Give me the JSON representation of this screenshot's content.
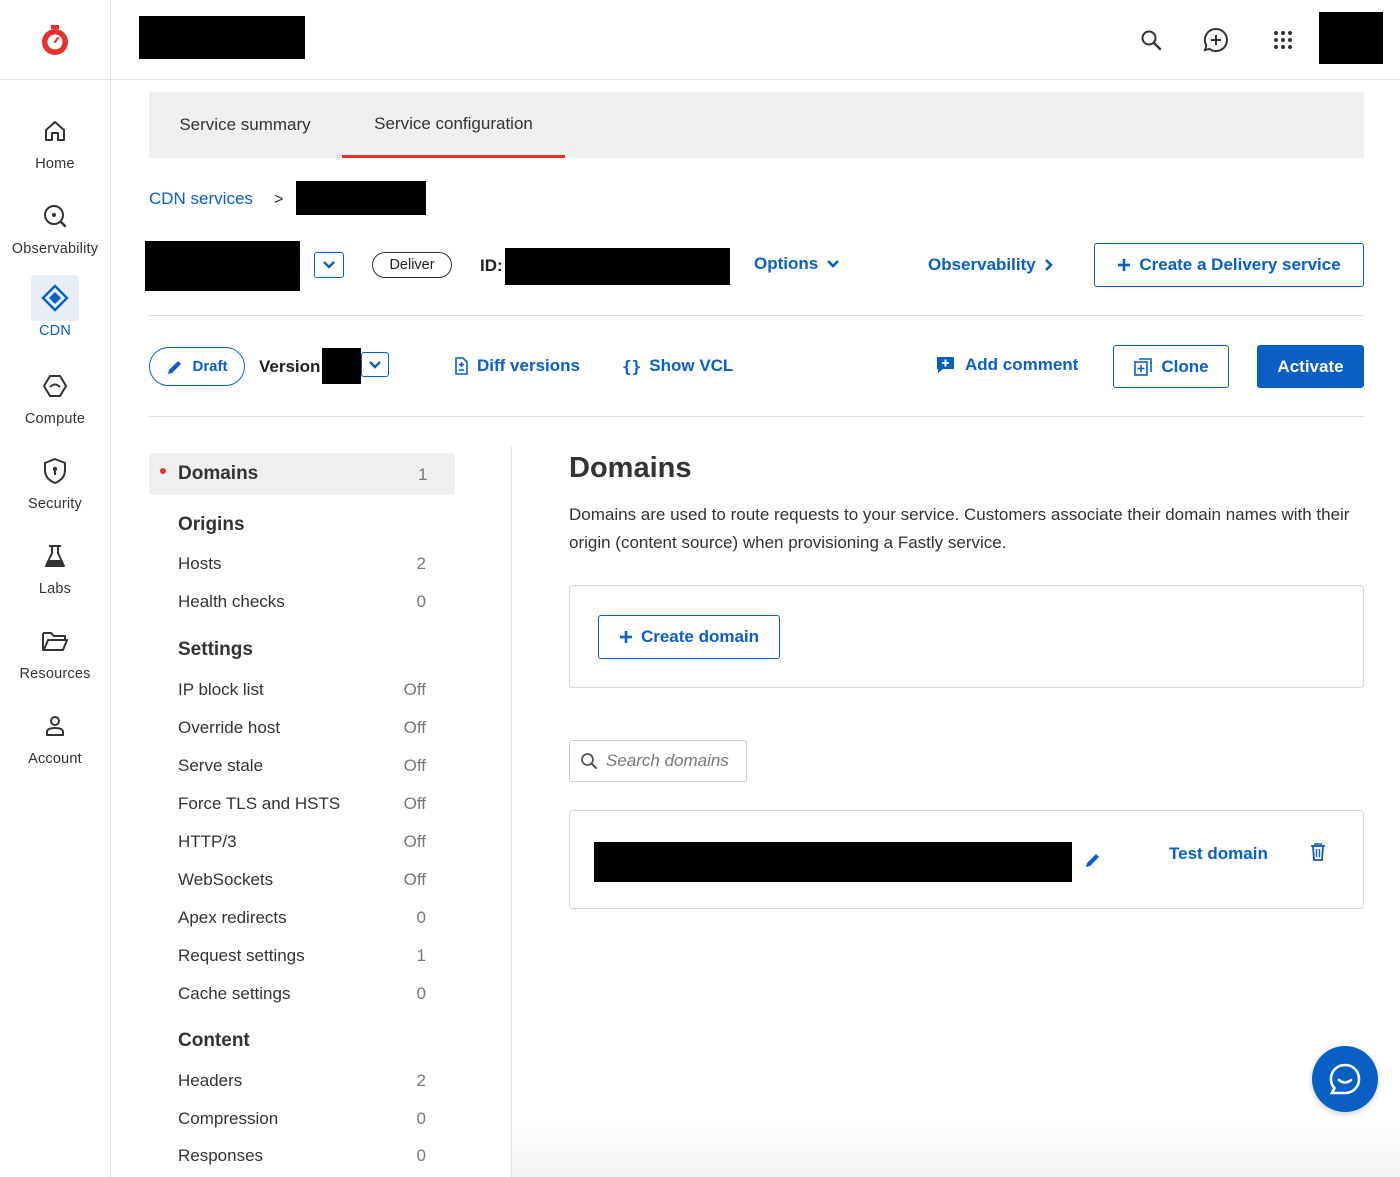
{
  "header": {
    "icons": [
      "search-icon",
      "feedback-icon",
      "apps-grid-icon"
    ]
  },
  "sidebar": {
    "items": [
      {
        "label": "Home",
        "icon": "home-icon"
      },
      {
        "label": "Observability",
        "icon": "observability-icon"
      },
      {
        "label": "CDN",
        "icon": "cdn-icon",
        "active": true
      },
      {
        "label": "Compute",
        "icon": "compute-icon"
      },
      {
        "label": "Security",
        "icon": "shield-icon"
      },
      {
        "label": "Labs",
        "icon": "flask-icon"
      },
      {
        "label": "Resources",
        "icon": "folder-icon"
      },
      {
        "label": "Account",
        "icon": "user-icon"
      }
    ]
  },
  "tabs": [
    {
      "label": "Service summary"
    },
    {
      "label": "Service configuration",
      "active": true
    }
  ],
  "breadcrumb": {
    "root": "CDN services",
    "separator": ">"
  },
  "service_header": {
    "type_badge": "Deliver",
    "id_label": "ID:",
    "options_label": "Options",
    "observability_label": "Observability",
    "create_button": "Create a Delivery service"
  },
  "version_bar": {
    "draft_label": "Draft",
    "version_label": "Version",
    "diff_label": "Diff versions",
    "vcl_label": "Show VCL",
    "comment_label": "Add comment",
    "clone_label": "Clone",
    "activate_label": "Activate"
  },
  "config_menu": {
    "domains": {
      "label": "Domains",
      "count": "1"
    },
    "origins_heading": "Origins",
    "origins": [
      {
        "label": "Hosts",
        "value": "2"
      },
      {
        "label": "Health checks",
        "value": "0"
      }
    ],
    "settings_heading": "Settings",
    "settings": [
      {
        "label": "IP block list",
        "value": "Off"
      },
      {
        "label": "Override host",
        "value": "Off"
      },
      {
        "label": "Serve stale",
        "value": "Off"
      },
      {
        "label": "Force TLS and HSTS",
        "value": "Off"
      },
      {
        "label": "HTTP/3",
        "value": "Off"
      },
      {
        "label": "WebSockets",
        "value": "Off"
      },
      {
        "label": "Apex redirects",
        "value": "0"
      },
      {
        "label": "Request settings",
        "value": "1"
      },
      {
        "label": "Cache settings",
        "value": "0"
      }
    ],
    "content_heading": "Content",
    "content": [
      {
        "label": "Headers",
        "value": "2"
      },
      {
        "label": "Compression",
        "value": "0"
      },
      {
        "label": "Responses",
        "value": "0"
      }
    ]
  },
  "domains_panel": {
    "title": "Domains",
    "description": "Domains are used to route requests to your service. Customers associate their domain names with their origin (content source) when provisioning a Fastly service.",
    "create_button": "Create domain",
    "search_placeholder": "Search domains",
    "row_test_label": "Test domain"
  },
  "colors": {
    "accent": "#0a5fc4",
    "brand_red": "#e8302c",
    "active_indicator": "#e8302c"
  }
}
